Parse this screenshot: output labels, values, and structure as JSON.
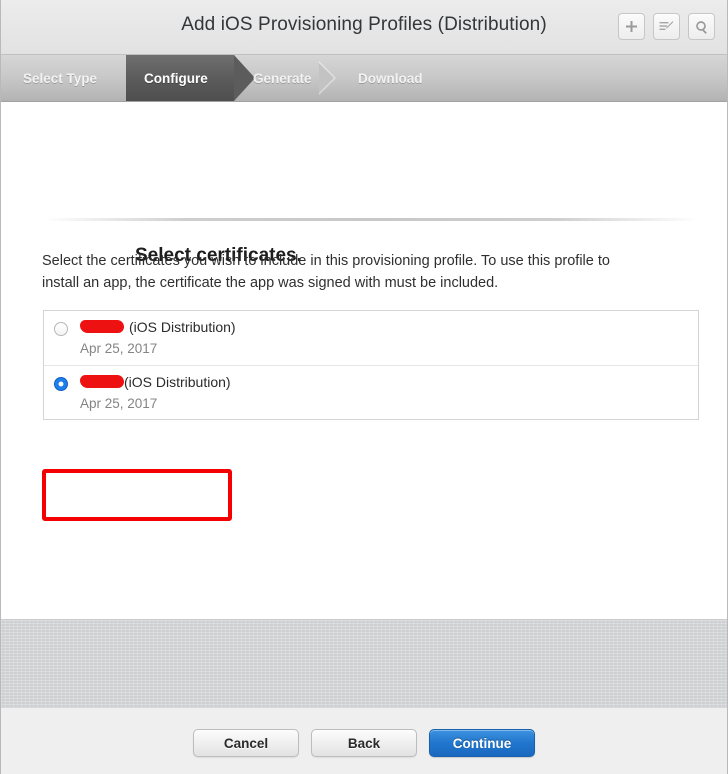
{
  "window": {
    "title": "Add iOS Provisioning Profiles (Distribution)"
  },
  "titlebar": {
    "actions": [
      {
        "name": "add-button",
        "icon": "plus-icon"
      },
      {
        "name": "edit-button",
        "icon": "edit-list-icon"
      },
      {
        "name": "search-button",
        "icon": "search-icon"
      }
    ]
  },
  "steps": [
    {
      "label": "Select Type",
      "state": "completed"
    },
    {
      "label": "Configure",
      "state": "active"
    },
    {
      "label": "Generate",
      "state": "upcoming"
    },
    {
      "label": "Download",
      "state": "upcoming"
    }
  ],
  "main": {
    "heading": "Select certificates.",
    "instructions": "Select the certificates you wish to include in this provisioning profile. To use this profile to install an app, the certificate the app was signed with must be included.",
    "certificates": [
      {
        "name_redacted": true,
        "type": "(iOS Distribution)",
        "date": "Apr 25, 2017",
        "selected": false,
        "highlighted": false
      },
      {
        "name_redacted": true,
        "type": "(iOS Distribution)",
        "date": "Apr 25, 2017",
        "selected": true,
        "highlighted": true
      }
    ]
  },
  "footer": {
    "cancel_label": "Cancel",
    "back_label": "Back",
    "continue_label": "Continue"
  },
  "colors": {
    "accent": "#2176cd",
    "annotation": "#f40000",
    "redaction": "#ee1111",
    "active_step": "#5c5c5c"
  }
}
